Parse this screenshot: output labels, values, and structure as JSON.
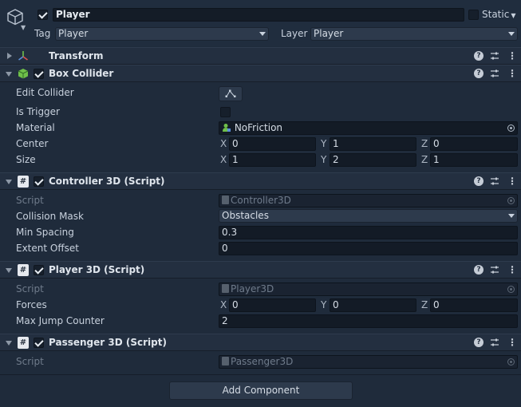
{
  "header": {
    "object_name": "Player",
    "active": true,
    "static_label": "Static",
    "static_checked": false,
    "tag_label": "Tag",
    "tag_value": "Player",
    "layer_label": "Layer",
    "layer_value": "Player"
  },
  "transform": {
    "title": "Transform"
  },
  "box_collider": {
    "title": "Box Collider",
    "enabled": true,
    "edit_collider_label": "Edit Collider",
    "is_trigger_label": "Is Trigger",
    "is_trigger": false,
    "material_label": "Material",
    "material_value": "NoFriction",
    "center_label": "Center",
    "center": {
      "x": "0",
      "y": "1",
      "z": "0"
    },
    "size_label": "Size",
    "size": {
      "x": "1",
      "y": "2",
      "z": "1"
    }
  },
  "controller3d": {
    "title": "Controller 3D (Script)",
    "enabled": true,
    "script_label": "Script",
    "script_value": "Controller3D",
    "collision_mask_label": "Collision Mask",
    "collision_mask_value": "Obstacles",
    "min_spacing_label": "Min Spacing",
    "min_spacing_value": "0.3",
    "extent_offset_label": "Extent Offset",
    "extent_offset_value": "0"
  },
  "player3d": {
    "title": "Player 3D (Script)",
    "enabled": true,
    "script_label": "Script",
    "script_value": "Player3D",
    "forces_label": "Forces",
    "forces": {
      "x": "0",
      "y": "0",
      "z": "0"
    },
    "max_jump_label": "Max Jump Counter",
    "max_jump_value": "2"
  },
  "passenger3d": {
    "title": "Passenger 3D (Script)",
    "enabled": true,
    "script_label": "Script",
    "script_value": "Passenger3D"
  },
  "axis_labels": {
    "x": "X",
    "y": "Y",
    "z": "Z"
  },
  "header_buttons": {
    "help": "?",
    "menu": "⋮"
  },
  "script_icon_glyph": "#",
  "add_component_label": "Add Component",
  "icons": {
    "object": "gameobject-cube-icon",
    "transform": "transform-axes-icon",
    "box_collider": "box-collider-icon",
    "script": "script-hash-icon",
    "help": "help-icon",
    "presets": "presets-sliders-icon",
    "menu": "kebab-menu-icon",
    "target": "object-picker-icon",
    "edit_collider": "edit-bounds-icon"
  },
  "colors": {
    "background": "#1f2b3b",
    "header": "#232f40",
    "field": "#131b26",
    "accent_green": "#6fbf4a"
  }
}
